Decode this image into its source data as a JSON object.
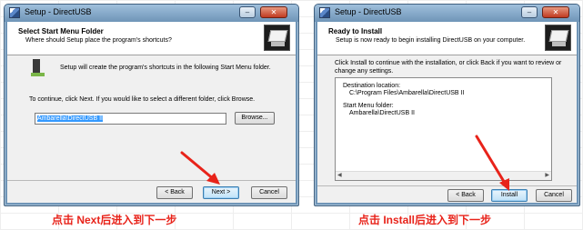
{
  "colors": {
    "arrow": "#e8231a",
    "caption": "#e8231a"
  },
  "left_window": {
    "title": "Setup - DirectUSB",
    "header_title": "Select Start Menu Folder",
    "header_subtitle": "Where should Setup place the program's shortcuts?",
    "info_text": "Setup will create the program's shortcuts in the following Start Menu folder.",
    "instruction_text": "To continue, click Next. If you would like to select a different folder, click Browse.",
    "folder_value": "Ambarella\\DirectUSB II",
    "browse_label": "Browse...",
    "back_label": "< Back",
    "next_label": "Next >",
    "cancel_label": "Cancel",
    "icons": {
      "app": "setup-app-icon",
      "wizard": "computer-wizard-icon",
      "folder": "start-menu-folder-icon"
    }
  },
  "right_window": {
    "title": "Setup - DirectUSB",
    "header_title": "Ready to Install",
    "header_subtitle": "Setup is now ready to begin installing DirectUSB on your computer.",
    "instruction_line1": "Click Install to continue with the installation, or click Back if you want to review or",
    "instruction_line2": "change any settings.",
    "destination_label": "Destination location:",
    "destination_value": "C:\\Program Files\\Ambarella\\DirectUSB II",
    "startmenu_label": "Start Menu folder:",
    "startmenu_value": "Ambarella\\DirectUSB II",
    "back_label": "< Back",
    "install_label": "Install",
    "cancel_label": "Cancel"
  },
  "captions": {
    "left": "点击 Next后进入到下一步",
    "right": "点击 Install后进入到下一步"
  }
}
